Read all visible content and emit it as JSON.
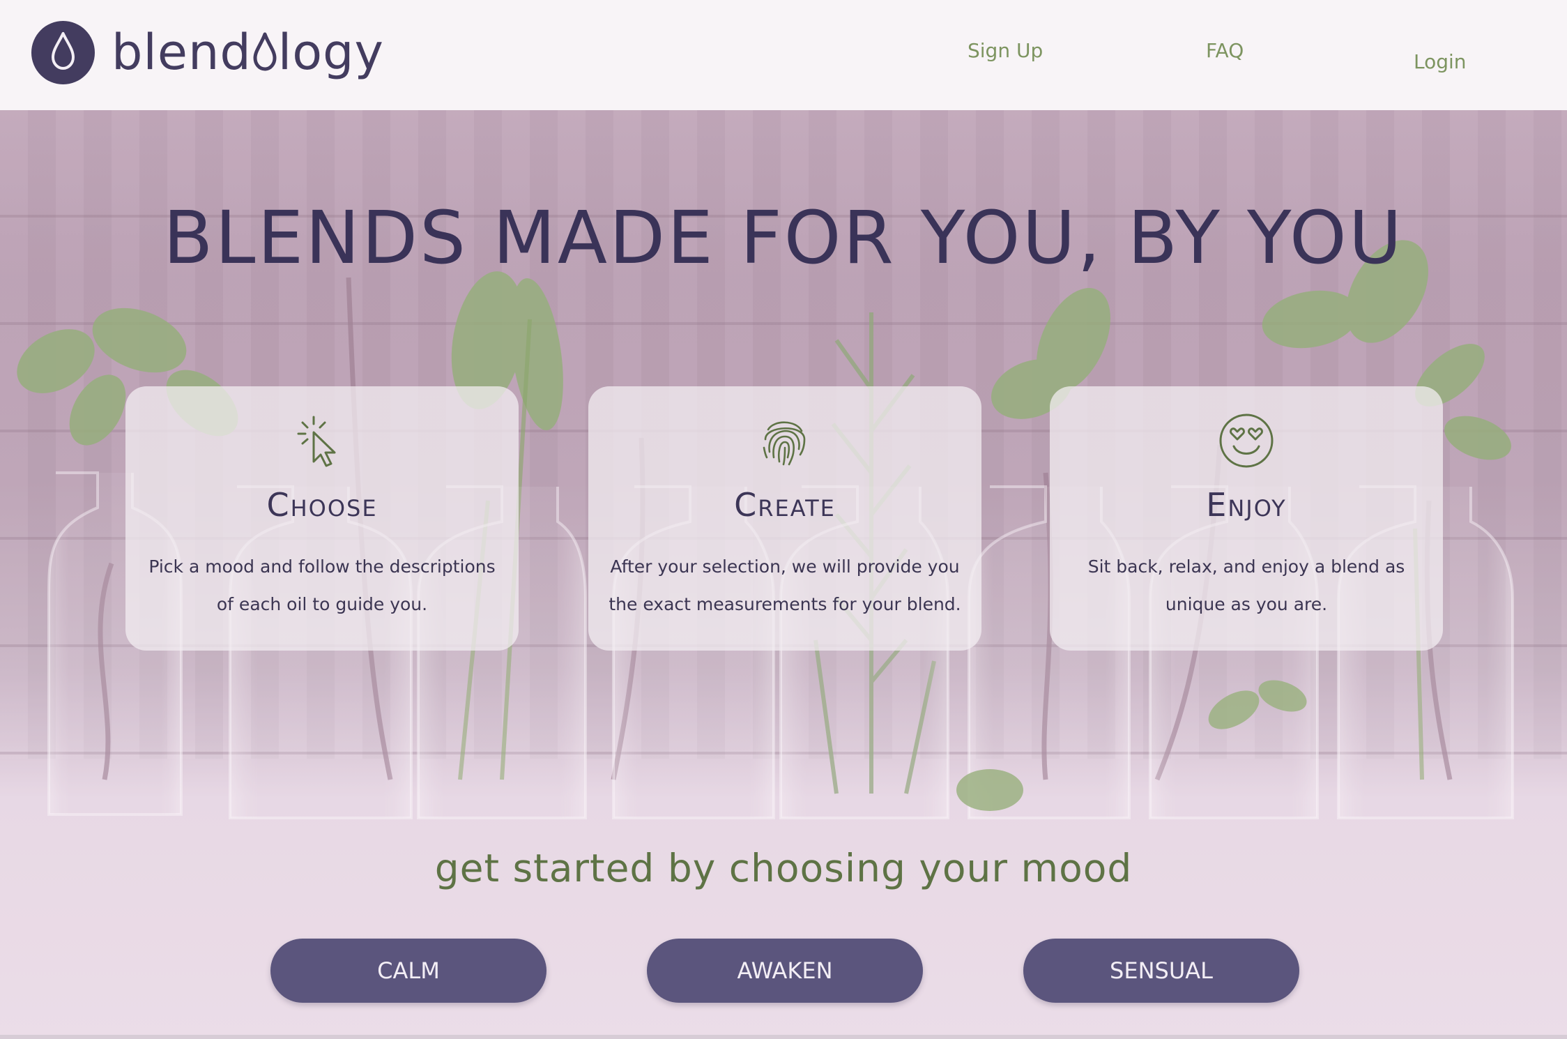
{
  "header": {
    "logo_text": "blend\u0000ology",
    "logo_text_display": "blend0logy",
    "nav": {
      "signup": "Sign Up",
      "faq": "FAQ",
      "login": "Login"
    }
  },
  "hero": {
    "title": "BLENDS MADE FOR YOU, BY YOU"
  },
  "steps": [
    {
      "icon": "cursor-click-icon",
      "title": "Choose",
      "text": "Pick a mood and follow the descriptions of each oil to guide you."
    },
    {
      "icon": "fingerprint-icon",
      "title": "Create",
      "text": "After your selection, we will provide you the exact measurements for your blend."
    },
    {
      "icon": "heart-eyes-smiley-icon",
      "title": "Enjoy",
      "text": "Sit back, relax, and enjoy a blend as unique as you are."
    }
  ],
  "cta": {
    "heading": "get started by choosing your mood",
    "buttons": [
      "CALM",
      "AWAKEN",
      "SENSUAL"
    ]
  },
  "colors": {
    "brand_purple": "#433c5f",
    "button_purple": "#5b557d",
    "accent_green": "#7d9460",
    "heading_green": "#5e7345"
  }
}
